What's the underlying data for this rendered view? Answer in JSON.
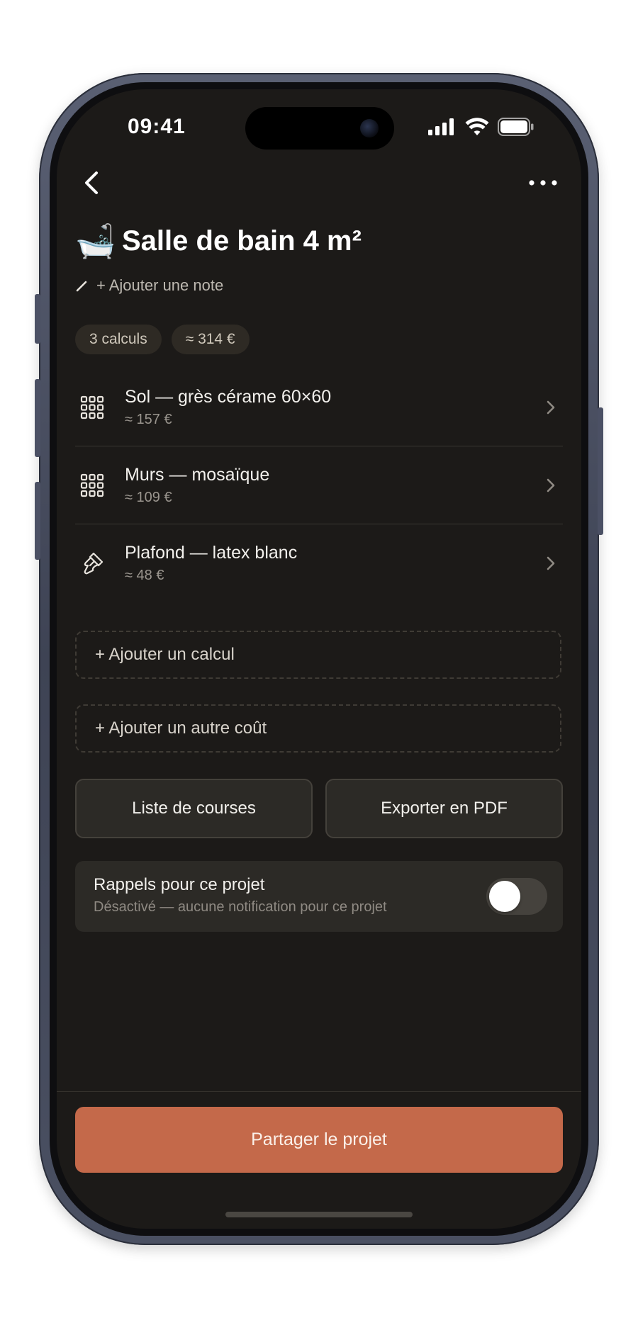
{
  "status_bar": {
    "time": "09:41"
  },
  "nav": {
    "back_icon": "chevron-left-icon",
    "more_icon": "more-horizontal-icon"
  },
  "project": {
    "emoji": "🛁",
    "title": "Salle de bain 4 m²",
    "add_note": "+ Ajouter une note"
  },
  "chips": [
    {
      "label": "3 calculs"
    },
    {
      "label": "≈ 314 €"
    }
  ],
  "calculations": [
    {
      "icon": "tile-grid-icon",
      "name": "Sol — grès cérame 60×60",
      "price": "≈ 157 €"
    },
    {
      "icon": "tile-grid-icon",
      "name": "Murs — mosaïque",
      "price": "≈ 109 €"
    },
    {
      "icon": "paint-brush-icon",
      "name": "Plafond — latex blanc",
      "price": "≈ 48 €"
    }
  ],
  "actions": {
    "add_calc": "+ Ajouter un calcul",
    "add_cost": "+ Ajouter un autre coût",
    "shopping_list": "Liste de courses",
    "export_pdf": "Exporter en PDF"
  },
  "reminders": {
    "title": "Rappels pour ce projet",
    "subtitle": "Désactivé — aucune notification pour ce projet",
    "enabled": false
  },
  "footer": {
    "share_label": "Partager le projet"
  },
  "colors": {
    "background": "#1c1a18",
    "accent": "#c4694a",
    "card": "#2c2a26",
    "chip": "#2e2a24"
  }
}
